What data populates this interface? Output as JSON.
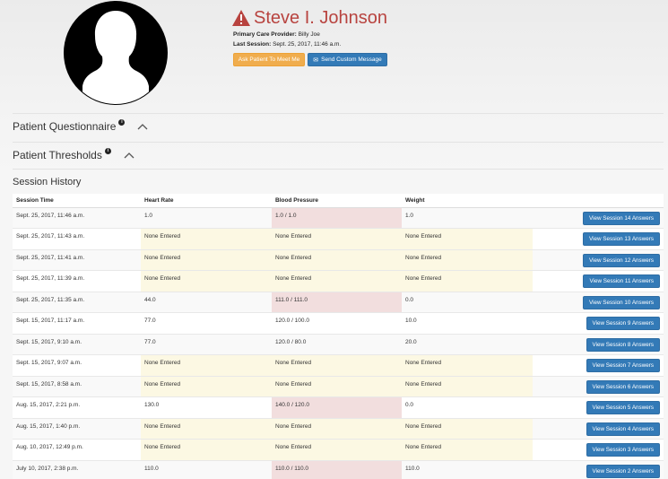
{
  "patient": {
    "name": "Steve I. Johnson",
    "provider_label": "Primary Care Provider:",
    "provider": "Billy Joe",
    "last_session_label": "Last Session:",
    "last_session": "Sept. 25, 2017, 11:46 a.m."
  },
  "actions": {
    "ask_label": "Ask Patient To Meet Me",
    "message_label": "Send Custom Message"
  },
  "sections": {
    "questionnaire": "Patient Questionnaire",
    "thresholds": "Patient Thresholds",
    "info_glyph": "i"
  },
  "history": {
    "title": "Session History",
    "columns": [
      "Session Time",
      "Heart Rate",
      "Blood Pressure",
      "Weight",
      ""
    ],
    "rows": [
      {
        "time": "Sept. 25, 2017, 11:46 a.m.",
        "hr": "1.0",
        "bp": "1.0 / 1.0",
        "weight": "1.0",
        "button": "View Session 14 Answers",
        "hr_state": "normal",
        "bp_state": "danger",
        "w_state": "normal"
      },
      {
        "time": "Sept. 25, 2017, 11:43 a.m.",
        "hr": "None Entered",
        "bp": "None Entered",
        "weight": "None Entered",
        "button": "View Session 13 Answers",
        "hr_state": "warning",
        "bp_state": "warning",
        "w_state": "warning"
      },
      {
        "time": "Sept. 25, 2017, 11:41 a.m.",
        "hr": "None Entered",
        "bp": "None Entered",
        "weight": "None Entered",
        "button": "View Session 12 Answers",
        "hr_state": "warning",
        "bp_state": "warning",
        "w_state": "warning"
      },
      {
        "time": "Sept. 25, 2017, 11:39 a.m.",
        "hr": "None Entered",
        "bp": "None Entered",
        "weight": "None Entered",
        "button": "View Session 11 Answers",
        "hr_state": "warning",
        "bp_state": "warning",
        "w_state": "warning"
      },
      {
        "time": "Sept. 25, 2017, 11:35 a.m.",
        "hr": "44.0",
        "bp": "111.0 / 111.0",
        "weight": "0.0",
        "button": "View Session 10 Answers",
        "hr_state": "normal",
        "bp_state": "danger",
        "w_state": "normal"
      },
      {
        "time": "Sept. 15, 2017, 11:17 a.m.",
        "hr": "77.0",
        "bp": "120.0 / 100.0",
        "weight": "10.0",
        "button": "View Session 9 Answers",
        "hr_state": "normal",
        "bp_state": "normal",
        "w_state": "normal"
      },
      {
        "time": "Sept. 15, 2017, 9:10 a.m.",
        "hr": "77.0",
        "bp": "120.0 / 80.0",
        "weight": "20.0",
        "button": "View Session 8 Answers",
        "hr_state": "normal",
        "bp_state": "normal",
        "w_state": "normal"
      },
      {
        "time": "Sept. 15, 2017, 9:07 a.m.",
        "hr": "None Entered",
        "bp": "None Entered",
        "weight": "None Entered",
        "button": "View Session 7 Answers",
        "hr_state": "warning",
        "bp_state": "warning",
        "w_state": "warning"
      },
      {
        "time": "Sept. 15, 2017, 8:58 a.m.",
        "hr": "None Entered",
        "bp": "None Entered",
        "weight": "None Entered",
        "button": "View Session 6 Answers",
        "hr_state": "warning",
        "bp_state": "warning",
        "w_state": "warning"
      },
      {
        "time": "Aug. 15, 2017, 2:21 p.m.",
        "hr": "130.0",
        "bp": "140.0 / 120.0",
        "weight": "0.0",
        "button": "View Session 5 Answers",
        "hr_state": "normal",
        "bp_state": "danger",
        "w_state": "normal"
      },
      {
        "time": "Aug. 15, 2017, 1:40 p.m.",
        "hr": "None Entered",
        "bp": "None Entered",
        "weight": "None Entered",
        "button": "View Session 4 Answers",
        "hr_state": "warning",
        "bp_state": "warning",
        "w_state": "warning"
      },
      {
        "time": "Aug. 10, 2017, 12:49 p.m.",
        "hr": "None Entered",
        "bp": "None Entered",
        "weight": "None Entered",
        "button": "View Session 3 Answers",
        "hr_state": "warning",
        "bp_state": "warning",
        "w_state": "warning"
      },
      {
        "time": "July 10, 2017, 2:38 p.m.",
        "hr": "110.0",
        "bp": "110.0 / 110.0",
        "weight": "110.0",
        "button": "View Session 2 Answers",
        "hr_state": "normal",
        "bp_state": "danger",
        "w_state": "normal"
      }
    ]
  },
  "colors": {
    "name_red": "#b8433f",
    "primary": "#337ab7",
    "warning_btn": "#f0ad4e",
    "warning_row": "#fcf8e3",
    "danger_row": "#f2dede"
  },
  "icons": {
    "avatar": "person-silhouette-icon",
    "alert": "warning-triangle-icon",
    "envelope": "envelope-icon",
    "info": "info-circle-icon",
    "chevron": "chevron-up-icon"
  }
}
